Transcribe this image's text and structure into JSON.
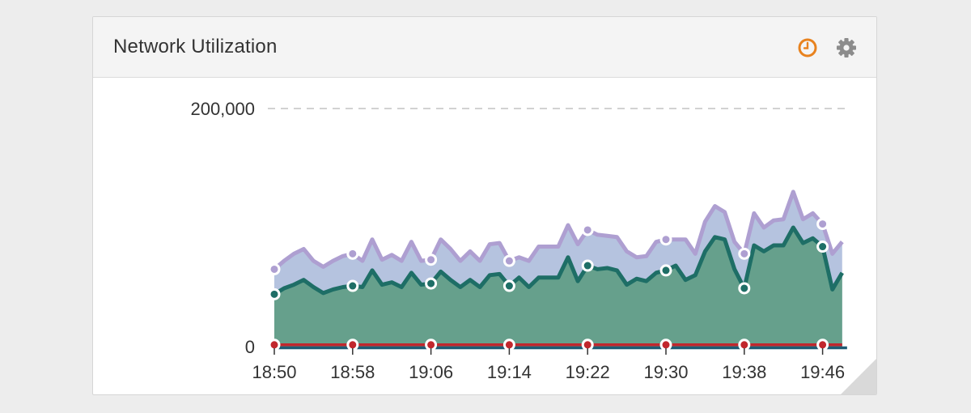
{
  "panel": {
    "title": "Network Utilization",
    "icons": {
      "clock": "clock-icon",
      "settings": "gear-icon"
    }
  },
  "chart_data": {
    "type": "area",
    "title": "Network Utilization",
    "xlabel": "",
    "ylabel": "",
    "ylim": [
      0,
      200000
    ],
    "y_ticks": [
      "0",
      "200,000"
    ],
    "x_ticks": [
      "18:50",
      "18:58",
      "19:06",
      "19:14",
      "19:22",
      "19:30",
      "19:38",
      "19:46"
    ],
    "x_minutes": [
      0,
      8,
      16,
      24,
      32,
      40,
      48,
      56
    ],
    "grid": "dashed line at 200,000",
    "stacked": true,
    "series": [
      {
        "color": "#ae9fd1",
        "fill": "#b5c3df",
        "minutes": [
          0,
          1,
          2,
          3,
          4,
          5,
          6,
          7,
          8,
          9,
          10,
          11,
          12,
          13,
          14,
          15,
          16,
          17,
          18,
          19,
          20,
          21,
          22,
          23,
          24,
          25,
          26,
          27,
          28,
          29,
          30,
          31,
          32,
          33,
          34,
          35,
          36,
          37,
          38,
          39,
          40,
          41,
          42,
          43,
          44,
          45,
          46,
          47,
          48,
          49,
          50,
          51,
          52,
          53,
          54,
          55,
          56,
          57,
          58
        ],
        "values": [
          65000,
          72000,
          78000,
          82000,
          72000,
          67000,
          72000,
          76000,
          78000,
          72000,
          90000,
          73000,
          77000,
          72000,
          88000,
          72000,
          73000,
          90000,
          82000,
          72000,
          80000,
          72000,
          86000,
          87000,
          72000,
          75000,
          72000,
          84000,
          84000,
          84000,
          102000,
          86000,
          98000,
          94000,
          93000,
          92000,
          80000,
          75000,
          76000,
          88000,
          90000,
          90000,
          90000,
          78000,
          105000,
          118000,
          113000,
          88000,
          78000,
          112000,
          100000,
          106000,
          107000,
          130000,
          107000,
          112000,
          103000,
          78000,
          88000
        ]
      },
      {
        "color": "#1e6e66",
        "fill": "#66a08c",
        "minutes": [
          0,
          1,
          2,
          3,
          4,
          5,
          6,
          7,
          8,
          9,
          10,
          11,
          12,
          13,
          14,
          15,
          16,
          17,
          18,
          19,
          20,
          21,
          22,
          23,
          24,
          25,
          26,
          27,
          28,
          29,
          30,
          31,
          32,
          33,
          34,
          35,
          36,
          37,
          38,
          39,
          40,
          41,
          42,
          43,
          44,
          45,
          46,
          47,
          48,
          49,
          50,
          51,
          52,
          53,
          54,
          55,
          56,
          57,
          58
        ],
        "values": [
          44000,
          49000,
          52000,
          56000,
          50000,
          45000,
          48000,
          50000,
          51000,
          50000,
          64000,
          52000,
          54000,
          50000,
          62000,
          52000,
          53000,
          63000,
          56000,
          50000,
          56000,
          50000,
          60000,
          61000,
          51000,
          58000,
          50000,
          58000,
          58000,
          58000,
          75000,
          55000,
          68000,
          65000,
          66000,
          64000,
          52000,
          57000,
          55000,
          62000,
          64000,
          68000,
          56000,
          60000,
          80000,
          92000,
          90000,
          65000,
          49000,
          85000,
          80000,
          85000,
          85000,
          100000,
          87000,
          91000,
          84000,
          48000,
          62000
        ]
      },
      {
        "color": "#c1272d",
        "fill": "none",
        "minutes": [
          0,
          58
        ],
        "values": [
          1500,
          1500
        ]
      },
      {
        "color": "#1e5b73",
        "fill": "none",
        "minutes": [
          0,
          58.5
        ],
        "values": [
          -1000,
          -1000
        ]
      }
    ],
    "markers": {
      "minutes": [
        0,
        8,
        16,
        24,
        32,
        40,
        48,
        56
      ],
      "series_index": [
        0,
        1,
        2
      ]
    }
  }
}
